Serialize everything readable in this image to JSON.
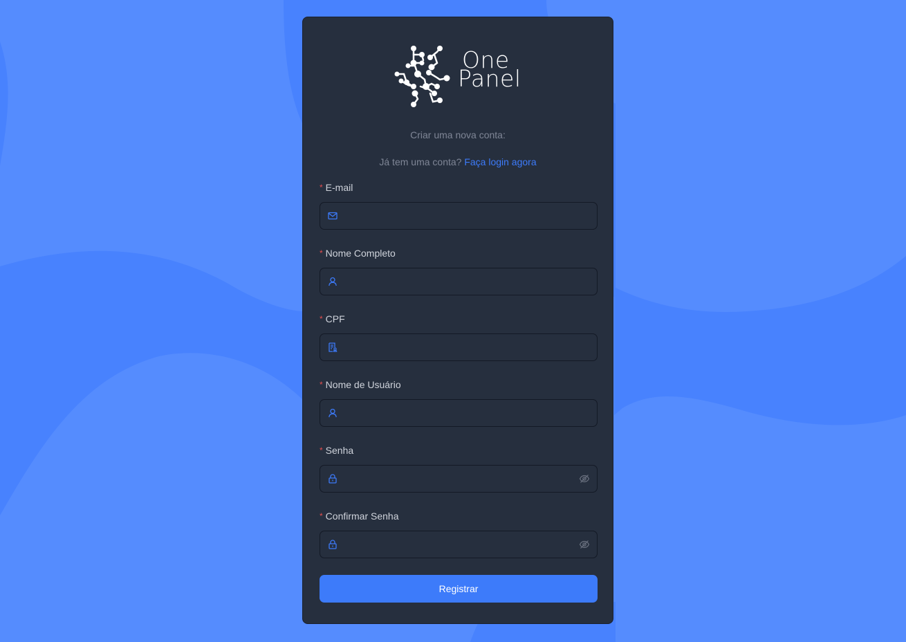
{
  "colors": {
    "background": "#558cfe",
    "background_dark": "#4882fe",
    "card": "#262f3e",
    "accent": "#3d7bfa",
    "required": "#e34e4e",
    "muted_text": "#7f8696"
  },
  "brand": {
    "line1": "One",
    "line2": "Panel"
  },
  "form": {
    "subtitle": "Criar uma nova conta:",
    "login_prompt": "Já tem uma conta?",
    "login_link": "Faça login agora",
    "required_mark": "*",
    "fields": [
      {
        "label": "E-mail",
        "icon": "mail-icon",
        "value": ""
      },
      {
        "label": "Nome Completo",
        "icon": "user-icon",
        "value": ""
      },
      {
        "label": "CPF",
        "icon": "document-icon",
        "value": ""
      },
      {
        "label": "Nome de Usuário",
        "icon": "user-icon",
        "value": ""
      },
      {
        "label": "Senha",
        "icon": "lock-icon",
        "trailing_icon": "eye-off-icon",
        "value": ""
      },
      {
        "label": "Confirmar Senha",
        "icon": "lock-icon",
        "trailing_icon": "eye-off-icon",
        "value": ""
      }
    ],
    "submit_label": "Registrar"
  }
}
